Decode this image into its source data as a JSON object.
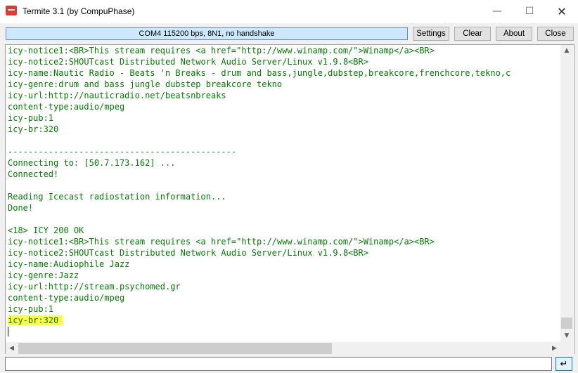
{
  "window": {
    "title": "Termite 3.1 (by CompuPhase)",
    "minimize_glyph": "—",
    "maximize_glyph": "☐",
    "close_glyph": "✕"
  },
  "toolbar": {
    "status": "COM4 115200 bps, 8N1, no handshake",
    "settings_label": "Settings",
    "clear_label": "Clear",
    "about_label": "About",
    "close_label": "Close"
  },
  "terminal": {
    "text_color": "#008000",
    "lines": [
      "icy-notice1:<BR>This stream requires <a href=\"http://www.winamp.com/\">Winamp</a><BR>",
      "icy-notice2:SHOUTcast Distributed Network Audio Server/Linux v1.9.8<BR>",
      "icy-name:Nautic Radio - Beats 'n Breaks - drum and bass,jungle,dubstep,breakcore,frenchcore,tekno,c",
      "icy-genre:drum and bass jungle dubstep breakcore tekno",
      "icy-url:http://nauticradio.net/beatsnbreaks",
      "content-type:audio/mpeg",
      "icy-pub:1",
      "icy-br:320",
      "",
      "---------------------------------------------",
      "Connecting to: [50.7.173.162] ...",
      "Connected!",
      "",
      "Reading Icecast radiostation information...",
      "Done!",
      "",
      "<18> ICY 200 OK",
      "icy-notice1:<BR>This stream requires <a href=\"http://www.winamp.com/\">Winamp</a><BR>",
      "icy-notice2:SHOUTcast Distributed Network Audio Server/Linux v1.9.8<BR>",
      "icy-name:Audiophile Jazz",
      "icy-genre:Jazz",
      "icy-url:http://stream.psychomed.gr",
      "content-type:audio/mpeg",
      "icy-pub:1",
      "icy-br:320"
    ],
    "highlighted_line": 24,
    "highlight_color": "#ffff40"
  },
  "scrollbars": {
    "up_arrow": "▲",
    "down_arrow": "▼",
    "left_arrow": "◀",
    "right_arrow": "▶"
  },
  "input": {
    "value": "",
    "send_glyph": "↵"
  }
}
